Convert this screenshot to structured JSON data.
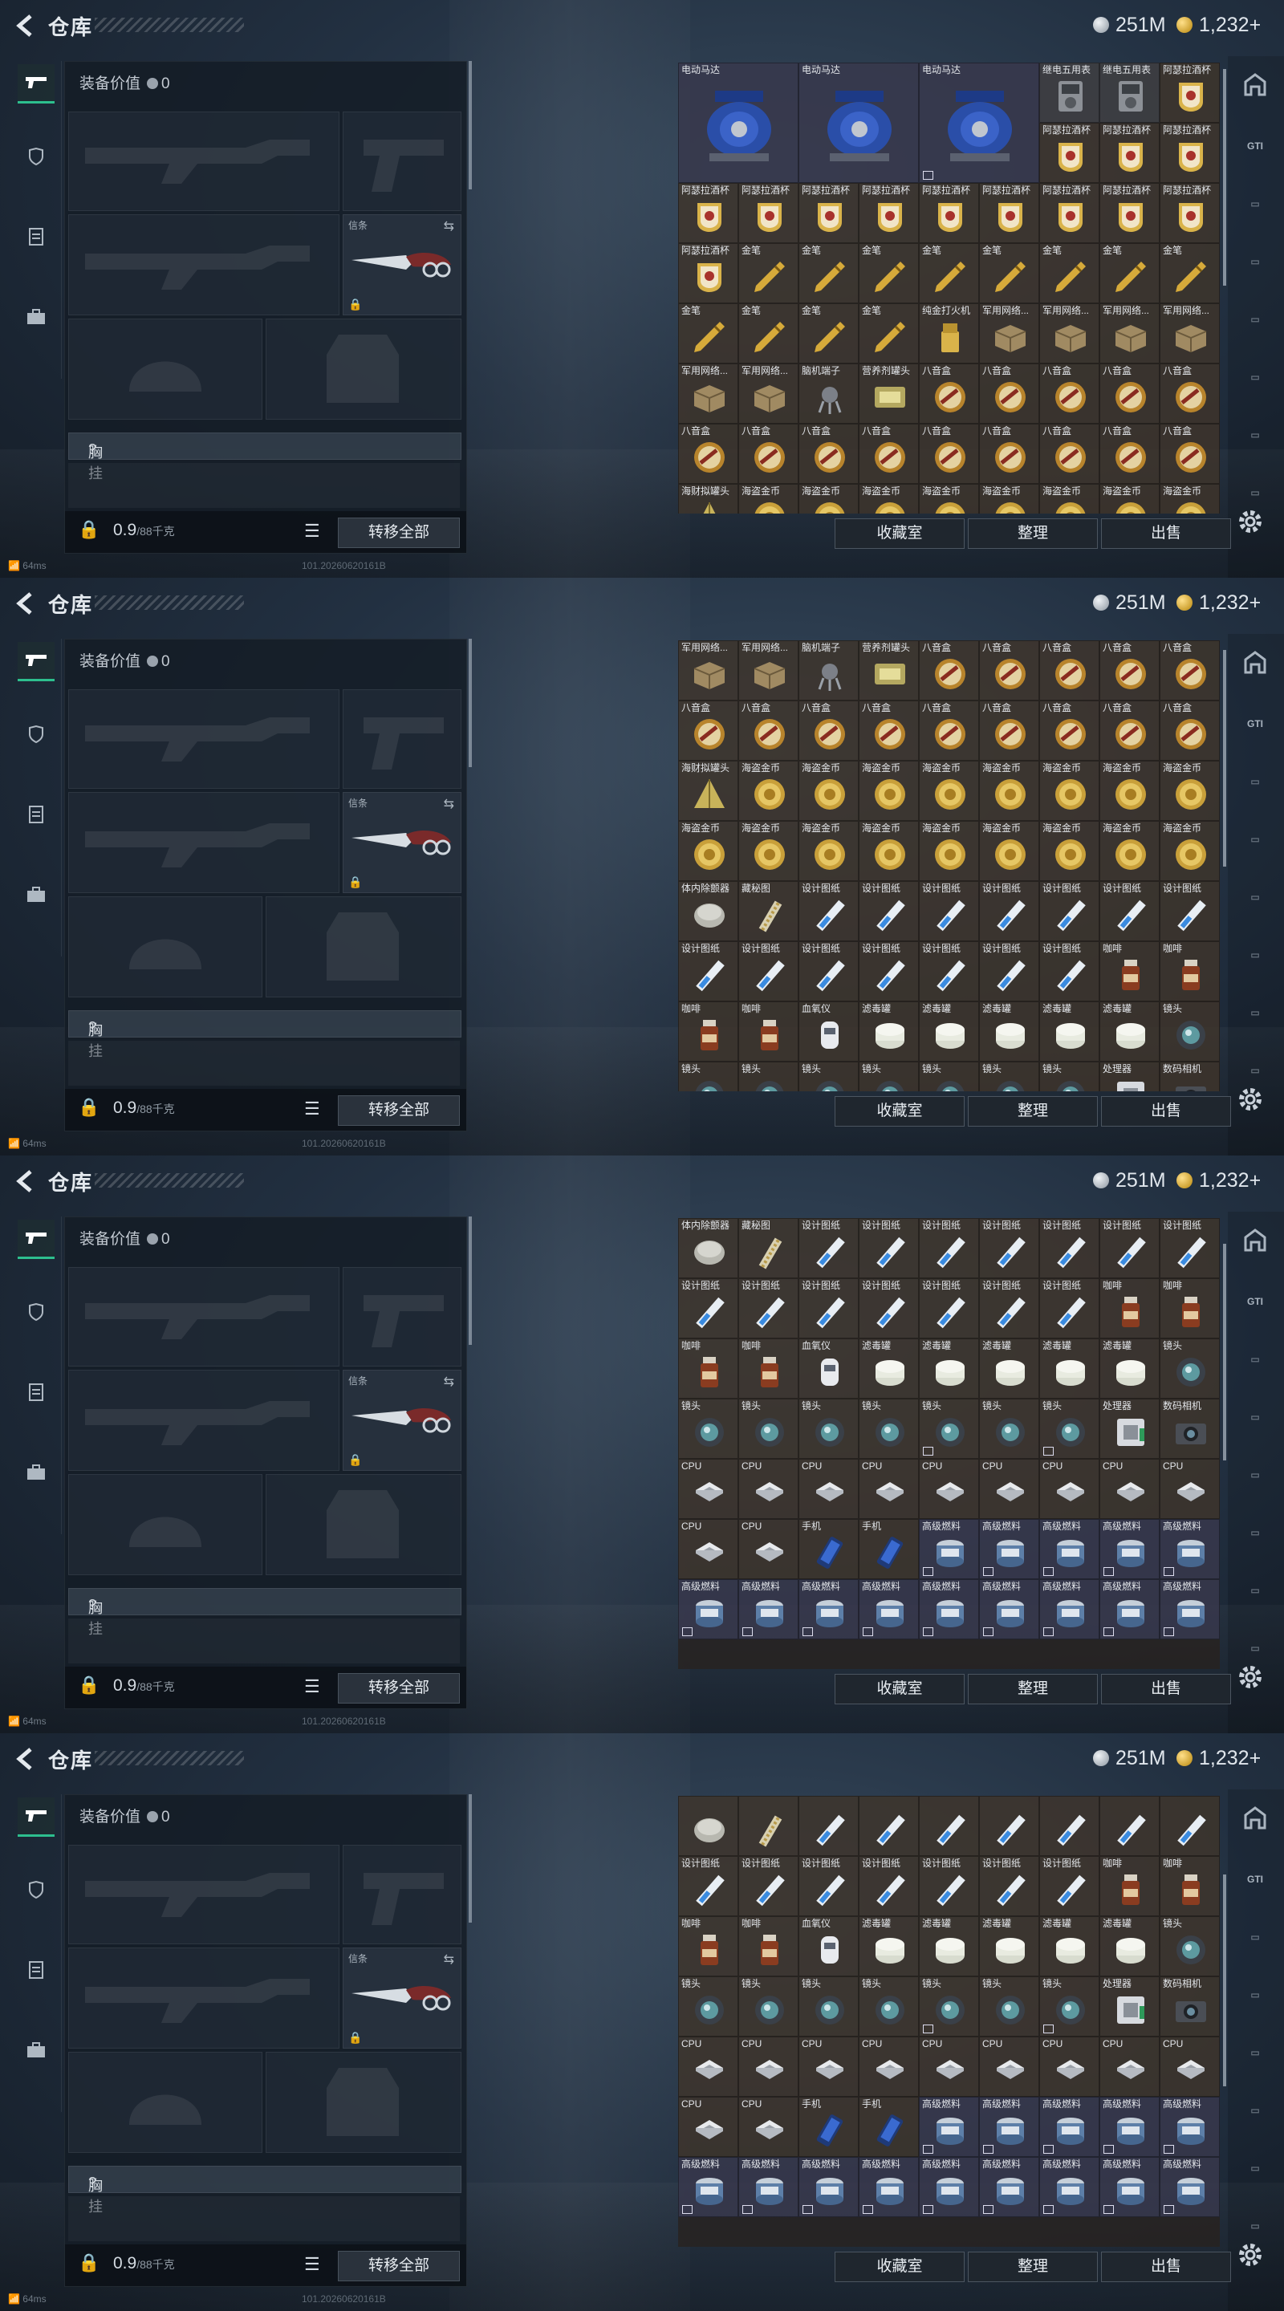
{
  "title": "仓库",
  "currency": {
    "silver": "251M",
    "gold": "1,232",
    "gold_plus": "+"
  },
  "equip": {
    "value_label": "装备价值",
    "value": "0",
    "melee_label": "信条",
    "rig_label": "胸挂",
    "rig_help": "?",
    "weight": "0.9",
    "weight_max": "/88千克",
    "transfer_all": "转移全部"
  },
  "actions": {
    "collection": "收藏室",
    "sort": "整理",
    "sell": "出售"
  },
  "status": {
    "ping": "64ms",
    "build": "101.20260620161B"
  },
  "colors": {
    "accent_green": "#2dbf8e",
    "panel": "#1f262e"
  },
  "frames": [
    {
      "items": [
        {
          "n": "电动马达",
          "t": "motor",
          "big": true,
          "c": "blue"
        },
        {
          "n": "电动马达",
          "t": "motor",
          "big": true,
          "c": "blue"
        },
        {
          "n": "电动马达",
          "t": "motor",
          "big": true,
          "c": "blue",
          "f": true
        },
        {
          "n": "继电五用表",
          "t": "meter",
          "c": "gray"
        },
        {
          "n": "继电五用表",
          "t": "meter",
          "c": "gray"
        },
        {
          "n": "阿瑟拉酒杯",
          "t": "cup"
        },
        {
          "n": "阿瑟拉酒杯",
          "t": "cup"
        },
        {
          "n": "阿瑟拉酒杯",
          "t": "cup"
        },
        {
          "n": "阿瑟拉酒杯",
          "t": "cup"
        },
        {
          "n": "阿瑟拉酒杯",
          "t": "cup"
        },
        {
          "n": "阿瑟拉酒杯",
          "t": "cup"
        },
        {
          "n": "阿瑟拉酒杯",
          "t": "cup"
        },
        {
          "n": "阿瑟拉酒杯",
          "t": "cup"
        },
        {
          "n": "阿瑟拉酒杯",
          "t": "cup"
        },
        {
          "n": "阿瑟拉酒杯",
          "t": "cup"
        },
        {
          "n": "阿瑟拉酒杯",
          "t": "cup"
        },
        {
          "n": "阿瑟拉酒杯",
          "t": "cup"
        },
        {
          "n": "阿瑟拉酒杯",
          "t": "cup"
        },
        {
          "n": "阿瑟拉酒杯",
          "t": "cup"
        },
        {
          "n": "金笔",
          "t": "pen"
        },
        {
          "n": "金笔",
          "t": "pen"
        },
        {
          "n": "金笔",
          "t": "pen"
        },
        {
          "n": "金笔",
          "t": "pen"
        },
        {
          "n": "金笔",
          "t": "pen"
        },
        {
          "n": "金笔",
          "t": "pen"
        },
        {
          "n": "金笔",
          "t": "pen"
        },
        {
          "n": "金笔",
          "t": "pen"
        },
        {
          "n": "金笔",
          "t": "pen"
        },
        {
          "n": "金笔",
          "t": "pen"
        },
        {
          "n": "金笔",
          "t": "pen"
        },
        {
          "n": "金笔",
          "t": "pen"
        },
        {
          "n": "纯金打火机",
          "t": "lighter"
        },
        {
          "n": "军用网络...",
          "t": "box"
        },
        {
          "n": "军用网络...",
          "t": "box"
        },
        {
          "n": "军用网络...",
          "t": "box"
        },
        {
          "n": "军用网络...",
          "t": "box"
        },
        {
          "n": "军用网络...",
          "t": "box"
        },
        {
          "n": "军用网络...",
          "t": "box"
        },
        {
          "n": "脑机端子",
          "t": "chip"
        },
        {
          "n": "营养剂罐头",
          "t": "can"
        },
        {
          "n": "八音盒",
          "t": "musicbox"
        },
        {
          "n": "八音盒",
          "t": "musicbox"
        },
        {
          "n": "八音盒",
          "t": "musicbox"
        },
        {
          "n": "八音盒",
          "t": "musicbox"
        },
        {
          "n": "八音盒",
          "t": "musicbox"
        },
        {
          "n": "八音盒",
          "t": "musicbox"
        },
        {
          "n": "八音盒",
          "t": "musicbox"
        },
        {
          "n": "八音盒",
          "t": "musicbox"
        },
        {
          "n": "八音盒",
          "t": "musicbox"
        },
        {
          "n": "八音盒",
          "t": "musicbox"
        },
        {
          "n": "八音盒",
          "t": "musicbox"
        },
        {
          "n": "八音盒",
          "t": "musicbox"
        },
        {
          "n": "八音盒",
          "t": "musicbox"
        },
        {
          "n": "八音盒",
          "t": "musicbox"
        },
        {
          "n": "海财拟罐头",
          "t": "pyramid"
        },
        {
          "n": "海盗金币",
          "t": "coin"
        },
        {
          "n": "海盗金币",
          "t": "coin"
        },
        {
          "n": "海盗金币",
          "t": "coin"
        },
        {
          "n": "海盗金币",
          "t": "coin"
        },
        {
          "n": "海盗金币",
          "t": "coin"
        },
        {
          "n": "海盗金币",
          "t": "coin"
        },
        {
          "n": "海盗金币",
          "t": "coin"
        },
        {
          "n": "海盗金币",
          "t": "coin"
        }
      ]
    },
    {
      "items": [
        {
          "n": "军用网络...",
          "t": "box"
        },
        {
          "n": "军用网络...",
          "t": "box"
        },
        {
          "n": "脑机端子",
          "t": "chip"
        },
        {
          "n": "营养剂罐头",
          "t": "can"
        },
        {
          "n": "八音盒",
          "t": "musicbox"
        },
        {
          "n": "八音盒",
          "t": "musicbox"
        },
        {
          "n": "八音盒",
          "t": "musicbox"
        },
        {
          "n": "八音盒",
          "t": "musicbox"
        },
        {
          "n": "八音盒",
          "t": "musicbox"
        },
        {
          "n": "八音盒",
          "t": "musicbox"
        },
        {
          "n": "八音盒",
          "t": "musicbox"
        },
        {
          "n": "八音盒",
          "t": "musicbox"
        },
        {
          "n": "八音盒",
          "t": "musicbox"
        },
        {
          "n": "八音盒",
          "t": "musicbox"
        },
        {
          "n": "八音盒",
          "t": "musicbox"
        },
        {
          "n": "八音盒",
          "t": "musicbox"
        },
        {
          "n": "八音盒",
          "t": "musicbox"
        },
        {
          "n": "八音盒",
          "t": "musicbox"
        },
        {
          "n": "海财拟罐头",
          "t": "pyramid"
        },
        {
          "n": "海盗金币",
          "t": "coin"
        },
        {
          "n": "海盗金币",
          "t": "coin"
        },
        {
          "n": "海盗金币",
          "t": "coin"
        },
        {
          "n": "海盗金币",
          "t": "coin"
        },
        {
          "n": "海盗金币",
          "t": "coin"
        },
        {
          "n": "海盗金币",
          "t": "coin"
        },
        {
          "n": "海盗金币",
          "t": "coin"
        },
        {
          "n": "海盗金币",
          "t": "coin"
        },
        {
          "n": "海盗金币",
          "t": "coin"
        },
        {
          "n": "海盗金币",
          "t": "coin"
        },
        {
          "n": "海盗金币",
          "t": "coin"
        },
        {
          "n": "海盗金币",
          "t": "coin"
        },
        {
          "n": "海盗金币",
          "t": "coin"
        },
        {
          "n": "海盗金币",
          "t": "coin"
        },
        {
          "n": "海盗金币",
          "t": "coin"
        },
        {
          "n": "海盗金币",
          "t": "coin"
        },
        {
          "n": "海盗金币",
          "t": "coin"
        },
        {
          "n": "体内除颤器",
          "t": "disc"
        },
        {
          "n": "藏秘图",
          "t": "drill"
        },
        {
          "n": "设计图纸",
          "t": "blueprint"
        },
        {
          "n": "设计图纸",
          "t": "blueprint"
        },
        {
          "n": "设计图纸",
          "t": "blueprint"
        },
        {
          "n": "设计图纸",
          "t": "blueprint"
        },
        {
          "n": "设计图纸",
          "t": "blueprint"
        },
        {
          "n": "设计图纸",
          "t": "blueprint"
        },
        {
          "n": "设计图纸",
          "t": "blueprint"
        },
        {
          "n": "设计图纸",
          "t": "blueprint"
        },
        {
          "n": "设计图纸",
          "t": "blueprint"
        },
        {
          "n": "设计图纸",
          "t": "blueprint"
        },
        {
          "n": "设计图纸",
          "t": "blueprint"
        },
        {
          "n": "设计图纸",
          "t": "blueprint"
        },
        {
          "n": "设计图纸",
          "t": "blueprint"
        },
        {
          "n": "设计图纸",
          "t": "blueprint"
        },
        {
          "n": "咖啡",
          "t": "coffee"
        },
        {
          "n": "咖啡",
          "t": "coffee"
        },
        {
          "n": "咖啡",
          "t": "coffee"
        },
        {
          "n": "咖啡",
          "t": "coffee"
        },
        {
          "n": "血氧仪",
          "t": "oxi"
        },
        {
          "n": "滤毒罐",
          "t": "filter"
        },
        {
          "n": "滤毒罐",
          "t": "filter"
        },
        {
          "n": "滤毒罐",
          "t": "filter"
        },
        {
          "n": "滤毒罐",
          "t": "filter"
        },
        {
          "n": "滤毒罐",
          "t": "filter"
        },
        {
          "n": "镜头",
          "t": "lens"
        },
        {
          "n": "镜头",
          "t": "lens"
        },
        {
          "n": "镜头",
          "t": "lens"
        },
        {
          "n": "镜头",
          "t": "lens"
        },
        {
          "n": "镜头",
          "t": "lens"
        },
        {
          "n": "镜头",
          "t": "lens"
        },
        {
          "n": "镜头",
          "t": "lens"
        },
        {
          "n": "镜头",
          "t": "lens"
        },
        {
          "n": "处理器",
          "t": "proc"
        },
        {
          "n": "数码相机",
          "t": "camera"
        }
      ]
    },
    {
      "items": [
        {
          "n": "体内除颤器",
          "t": "disc"
        },
        {
          "n": "藏秘图",
          "t": "drill"
        },
        {
          "n": "设计图纸",
          "t": "blueprint"
        },
        {
          "n": "设计图纸",
          "t": "blueprint"
        },
        {
          "n": "设计图纸",
          "t": "blueprint"
        },
        {
          "n": "设计图纸",
          "t": "blueprint"
        },
        {
          "n": "设计图纸",
          "t": "blueprint"
        },
        {
          "n": "设计图纸",
          "t": "blueprint"
        },
        {
          "n": "设计图纸",
          "t": "blueprint"
        },
        {
          "n": "设计图纸",
          "t": "blueprint"
        },
        {
          "n": "设计图纸",
          "t": "blueprint"
        },
        {
          "n": "设计图纸",
          "t": "blueprint"
        },
        {
          "n": "设计图纸",
          "t": "blueprint"
        },
        {
          "n": "设计图纸",
          "t": "blueprint"
        },
        {
          "n": "设计图纸",
          "t": "blueprint"
        },
        {
          "n": "设计图纸",
          "t": "blueprint"
        },
        {
          "n": "咖啡",
          "t": "coffee"
        },
        {
          "n": "咖啡",
          "t": "coffee"
        },
        {
          "n": "咖啡",
          "t": "coffee"
        },
        {
          "n": "咖啡",
          "t": "coffee"
        },
        {
          "n": "血氧仪",
          "t": "oxi"
        },
        {
          "n": "滤毒罐",
          "t": "filter"
        },
        {
          "n": "滤毒罐",
          "t": "filter"
        },
        {
          "n": "滤毒罐",
          "t": "filter"
        },
        {
          "n": "滤毒罐",
          "t": "filter"
        },
        {
          "n": "滤毒罐",
          "t": "filter"
        },
        {
          "n": "镜头",
          "t": "lens"
        },
        {
          "n": "镜头",
          "t": "lens"
        },
        {
          "n": "镜头",
          "t": "lens"
        },
        {
          "n": "镜头",
          "t": "lens"
        },
        {
          "n": "镜头",
          "t": "lens"
        },
        {
          "n": "镜头",
          "t": "lens",
          "f": true
        },
        {
          "n": "镜头",
          "t": "lens"
        },
        {
          "n": "镜头",
          "t": "lens",
          "f": true
        },
        {
          "n": "处理器",
          "t": "proc"
        },
        {
          "n": "数码相机",
          "t": "camera"
        },
        {
          "n": "CPU",
          "t": "cpu"
        },
        {
          "n": "CPU",
          "t": "cpu"
        },
        {
          "n": "CPU",
          "t": "cpu"
        },
        {
          "n": "CPU",
          "t": "cpu"
        },
        {
          "n": "CPU",
          "t": "cpu"
        },
        {
          "n": "CPU",
          "t": "cpu"
        },
        {
          "n": "CPU",
          "t": "cpu"
        },
        {
          "n": "CPU",
          "t": "cpu"
        },
        {
          "n": "CPU",
          "t": "cpu"
        },
        {
          "n": "CPU",
          "t": "cpu"
        },
        {
          "n": "CPU",
          "t": "cpu"
        },
        {
          "n": "手机",
          "t": "phone"
        },
        {
          "n": "手机",
          "t": "phone"
        },
        {
          "n": "高级燃料",
          "t": "fuel",
          "c": "blue",
          "f": true
        },
        {
          "n": "高级燃料",
          "t": "fuel",
          "c": "blue",
          "f": true
        },
        {
          "n": "高级燃料",
          "t": "fuel",
          "c": "blue",
          "f": true
        },
        {
          "n": "高级燃料",
          "t": "fuel",
          "c": "blue",
          "f": true
        },
        {
          "n": "高级燃料",
          "t": "fuel",
          "c": "blue",
          "f": true
        },
        {
          "n": "高级燃料",
          "t": "fuel",
          "c": "blue",
          "f": true
        },
        {
          "n": "高级燃料",
          "t": "fuel",
          "c": "blue",
          "f": true
        },
        {
          "n": "高级燃料",
          "t": "fuel",
          "c": "blue",
          "f": true
        },
        {
          "n": "高级燃料",
          "t": "fuel",
          "c": "blue",
          "f": true
        },
        {
          "n": "高级燃料",
          "t": "fuel",
          "c": "blue",
          "f": true
        },
        {
          "n": "高级燃料",
          "t": "fuel",
          "c": "blue",
          "f": true
        },
        {
          "n": "高级燃料",
          "t": "fuel",
          "c": "blue",
          "f": true
        },
        {
          "n": "高级燃料",
          "t": "fuel",
          "c": "blue",
          "f": true
        },
        {
          "n": "高级燃料",
          "t": "fuel",
          "c": "blue",
          "f": true
        }
      ]
    },
    {
      "items": [
        {
          "n": "",
          "t": "disc"
        },
        {
          "n": "",
          "t": "drill"
        },
        {
          "n": "",
          "t": "blueprint"
        },
        {
          "n": "",
          "t": "blueprint"
        },
        {
          "n": "",
          "t": "blueprint"
        },
        {
          "n": "",
          "t": "blueprint"
        },
        {
          "n": "",
          "t": "blueprint"
        },
        {
          "n": "",
          "t": "blueprint"
        },
        {
          "n": "",
          "t": "blueprint"
        },
        {
          "n": "设计图纸",
          "t": "blueprint"
        },
        {
          "n": "设计图纸",
          "t": "blueprint"
        },
        {
          "n": "设计图纸",
          "t": "blueprint"
        },
        {
          "n": "设计图纸",
          "t": "blueprint"
        },
        {
          "n": "设计图纸",
          "t": "blueprint"
        },
        {
          "n": "设计图纸",
          "t": "blueprint"
        },
        {
          "n": "设计图纸",
          "t": "blueprint"
        },
        {
          "n": "咖啡",
          "t": "coffee"
        },
        {
          "n": "咖啡",
          "t": "coffee"
        },
        {
          "n": "咖啡",
          "t": "coffee"
        },
        {
          "n": "咖啡",
          "t": "coffee"
        },
        {
          "n": "血氧仪",
          "t": "oxi"
        },
        {
          "n": "滤毒罐",
          "t": "filter"
        },
        {
          "n": "滤毒罐",
          "t": "filter"
        },
        {
          "n": "滤毒罐",
          "t": "filter"
        },
        {
          "n": "滤毒罐",
          "t": "filter"
        },
        {
          "n": "滤毒罐",
          "t": "filter"
        },
        {
          "n": "镜头",
          "t": "lens"
        },
        {
          "n": "镜头",
          "t": "lens"
        },
        {
          "n": "镜头",
          "t": "lens"
        },
        {
          "n": "镜头",
          "t": "lens"
        },
        {
          "n": "镜头",
          "t": "lens"
        },
        {
          "n": "镜头",
          "t": "lens",
          "f": true
        },
        {
          "n": "镜头",
          "t": "lens"
        },
        {
          "n": "镜头",
          "t": "lens",
          "f": true
        },
        {
          "n": "处理器",
          "t": "proc"
        },
        {
          "n": "数码相机",
          "t": "camera"
        },
        {
          "n": "CPU",
          "t": "cpu"
        },
        {
          "n": "CPU",
          "t": "cpu"
        },
        {
          "n": "CPU",
          "t": "cpu"
        },
        {
          "n": "CPU",
          "t": "cpu"
        },
        {
          "n": "CPU",
          "t": "cpu"
        },
        {
          "n": "CPU",
          "t": "cpu"
        },
        {
          "n": "CPU",
          "t": "cpu"
        },
        {
          "n": "CPU",
          "t": "cpu"
        },
        {
          "n": "CPU",
          "t": "cpu"
        },
        {
          "n": "CPU",
          "t": "cpu"
        },
        {
          "n": "CPU",
          "t": "cpu"
        },
        {
          "n": "手机",
          "t": "phone"
        },
        {
          "n": "手机",
          "t": "phone"
        },
        {
          "n": "高级燃料",
          "t": "fuel",
          "c": "blue",
          "f": true
        },
        {
          "n": "高级燃料",
          "t": "fuel",
          "c": "blue",
          "f": true
        },
        {
          "n": "高级燃料",
          "t": "fuel",
          "c": "blue",
          "f": true
        },
        {
          "n": "高级燃料",
          "t": "fuel",
          "c": "blue",
          "f": true
        },
        {
          "n": "高级燃料",
          "t": "fuel",
          "c": "blue",
          "f": true
        },
        {
          "n": "高级燃料",
          "t": "fuel",
          "c": "blue",
          "f": true
        },
        {
          "n": "高级燃料",
          "t": "fuel",
          "c": "blue",
          "f": true
        },
        {
          "n": "高级燃料",
          "t": "fuel",
          "c": "blue",
          "f": true
        },
        {
          "n": "高级燃料",
          "t": "fuel",
          "c": "blue",
          "f": true
        },
        {
          "n": "高级燃料",
          "t": "fuel",
          "c": "blue",
          "f": true
        },
        {
          "n": "高级燃料",
          "t": "fuel",
          "c": "blue",
          "f": true
        },
        {
          "n": "高级燃料",
          "t": "fuel",
          "c": "blue",
          "f": true
        },
        {
          "n": "高级燃料",
          "t": "fuel",
          "c": "blue",
          "f": true
        },
        {
          "n": "高级燃料",
          "t": "fuel",
          "c": "blue",
          "f": true
        }
      ]
    }
  ]
}
